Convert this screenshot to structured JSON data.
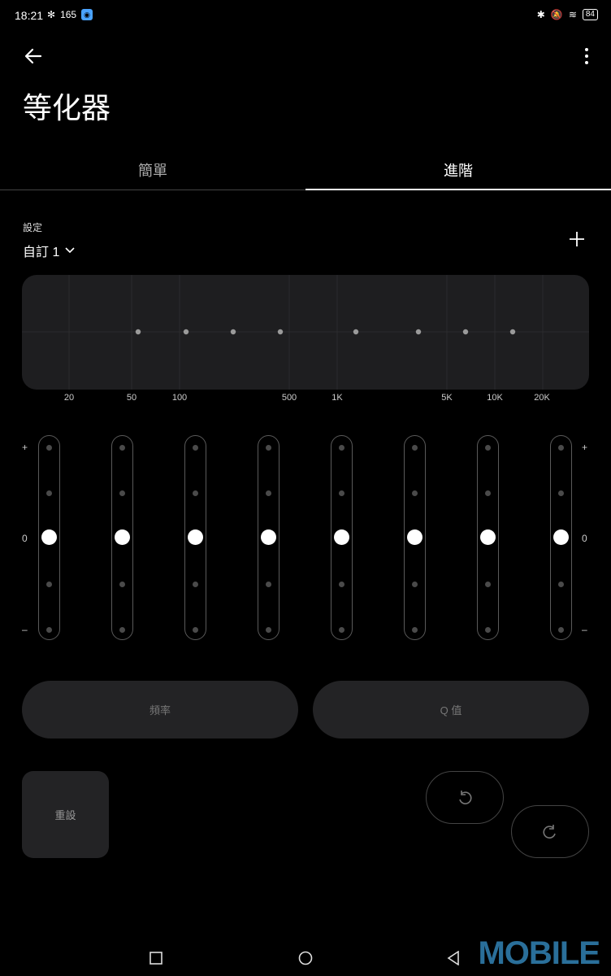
{
  "status_bar": {
    "time": "18:21",
    "network_speed": "165",
    "battery": "84"
  },
  "header": {
    "title": "等化器"
  },
  "tabs": [
    {
      "label": "簡單",
      "active": false
    },
    {
      "label": "進階",
      "active": true
    }
  ],
  "settings": {
    "label": "設定",
    "preset": "自訂 1"
  },
  "graph": {
    "freq_labels": [
      "20",
      "50",
      "100",
      "500",
      "1K",
      "5K",
      "10K",
      "20K"
    ],
    "band_count": 8
  },
  "sliders": {
    "plus_label": "+",
    "zero_label": "0",
    "minus_label": "–",
    "bands": [
      {
        "name": "band-1",
        "level": 0
      },
      {
        "name": "band-2",
        "level": 0
      },
      {
        "name": "band-3",
        "level": 0
      },
      {
        "name": "band-4",
        "level": 0
      },
      {
        "name": "band-5",
        "level": 0
      },
      {
        "name": "band-6",
        "level": 0
      },
      {
        "name": "band-7",
        "level": 0
      },
      {
        "name": "band-8",
        "level": 0
      }
    ]
  },
  "controls": {
    "frequency_label": "頻率",
    "q_label": "Q 值",
    "reset_label": "重設"
  },
  "watermark": "MOBILE",
  "icons": {
    "back": "arrow-left-icon",
    "more": "more-vertical-icon",
    "add": "plus-icon",
    "undo": "undo-icon",
    "redo": "redo-icon"
  },
  "colors": {
    "background": "#000000",
    "panel": "#1e1e20",
    "button": "#232325",
    "watermark": "#2a6f9a"
  }
}
